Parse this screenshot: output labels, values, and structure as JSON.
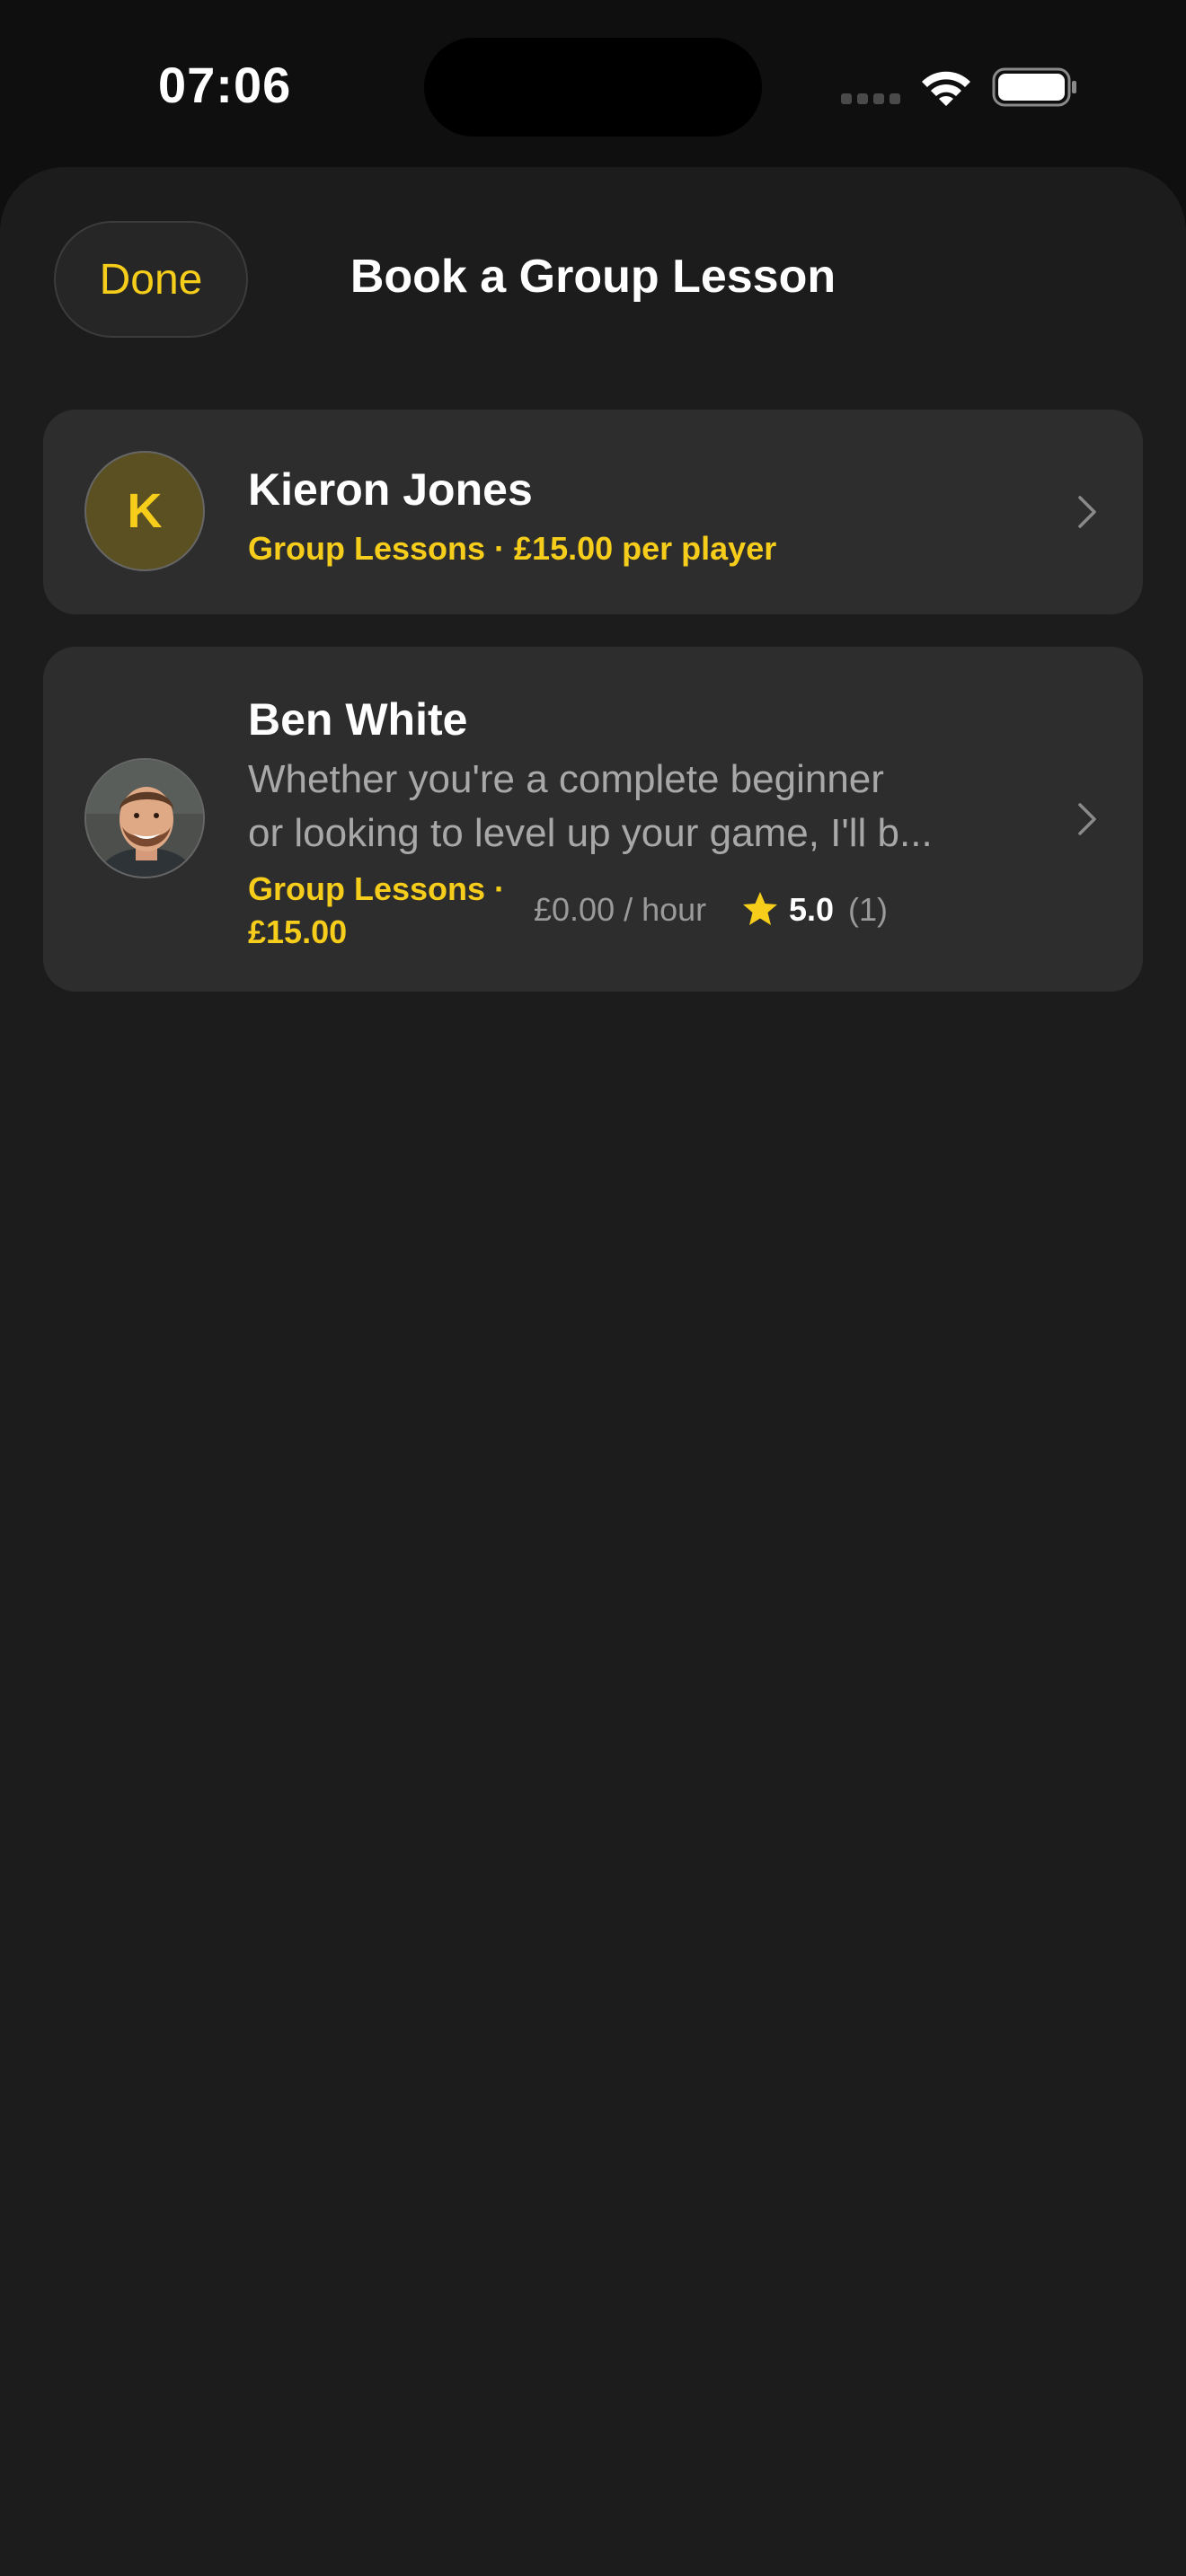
{
  "status_bar": {
    "time": "07:06",
    "icons": [
      "cellular-signal-icon",
      "wifi-icon",
      "battery-icon"
    ]
  },
  "sheet": {
    "done_label": "Done",
    "title": "Book a Group Lesson"
  },
  "coaches": [
    {
      "avatar_initial": "K",
      "name": "Kieron Jones",
      "subtitle": "Group Lessons · £15.00 per player"
    },
    {
      "name": "Ben White",
      "description_line1": "Whether you're a complete beginner",
      "description_line2": "or looking to level up your game, I'll b...",
      "group_lessons_line1": "Group Lessons ·",
      "group_lessons_line2": "£15.00",
      "hourly_rate": "£0.00 / hour",
      "rating": "5.0",
      "rating_count": "(1)"
    }
  ],
  "colors": {
    "accent": "#f5cd1a",
    "background": "#1c1c1c",
    "card": "#2d2d2d",
    "secondary_text": "#a8a8a8"
  }
}
